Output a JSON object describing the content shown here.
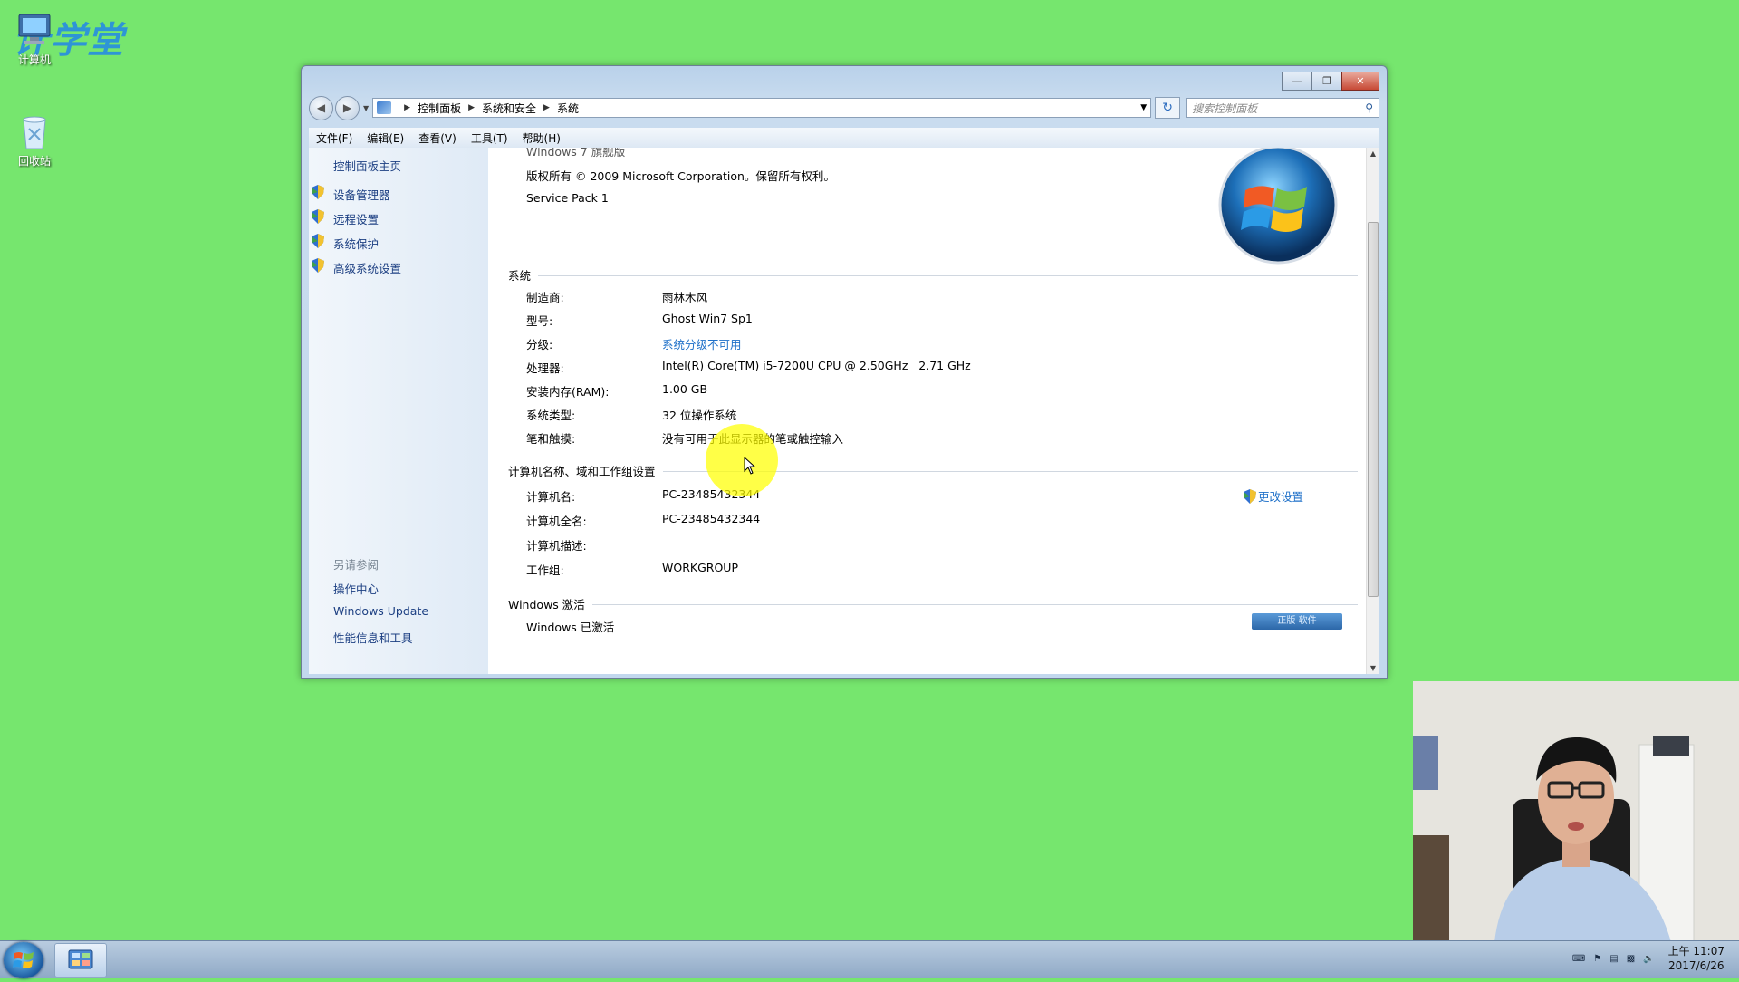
{
  "desktop": {
    "watermark": "计学堂",
    "icons": [
      "计算机",
      "回收站"
    ]
  },
  "window": {
    "address": [
      "控制面板",
      "系统和安全",
      "系统"
    ],
    "search_placeholder": "搜索控制面板",
    "menu": [
      "文件(F)",
      "编辑(E)",
      "查看(V)",
      "工具(T)",
      "帮助(H)"
    ],
    "left": {
      "home": "控制面板主页",
      "links": [
        "设备管理器",
        "远程设置",
        "系统保护",
        "高级系统设置"
      ],
      "see_also": "另请参阅",
      "see_links": [
        "操作中心",
        "Windows Update",
        "性能信息和工具"
      ]
    },
    "main": {
      "edition_partial": "Windows 7 旗舰版",
      "copyright": "版权所有 © 2009 Microsoft Corporation。保留所有权利。",
      "service_pack": "Service Pack 1",
      "system_title": "系统",
      "system_rows": [
        {
          "label": "制造商:",
          "value": "雨林木风"
        },
        {
          "label": "型号:",
          "value": "Ghost Win7 Sp1"
        },
        {
          "label": "分级:",
          "value": "系统分级不可用"
        },
        {
          "label": "处理器:",
          "value": "Intel(R) Core(TM) i5-7200U CPU @ 2.50GHz   2.71 GHz"
        },
        {
          "label": "安装内存(RAM):",
          "value": "1.00 GB"
        },
        {
          "label": "系统类型:",
          "value": "32 位操作系统"
        },
        {
          "label": "笔和触摸:",
          "value": "没有可用于此显示器的笔或触控输入"
        }
      ],
      "computer_title": "计算机名称、域和工作组设置",
      "computer_rows": [
        {
          "label": "计算机名:",
          "value": "PC-23485432344"
        },
        {
          "label": "计算机全名:",
          "value": "PC-23485432344"
        },
        {
          "label": "计算机描述:",
          "value": ""
        },
        {
          "label": "工作组:",
          "value": "WORKGROUP"
        }
      ],
      "change_settings": "更改设置",
      "activation_title": "Windows 激活",
      "activation_status": "Windows 已激活",
      "genuine_partial": "正版 软件"
    }
  },
  "taskbar": {
    "time": "上午 11:07",
    "date": "2017/6/26"
  },
  "colors": {
    "desktop": "#76e66e",
    "link": "#1d6fc8"
  }
}
